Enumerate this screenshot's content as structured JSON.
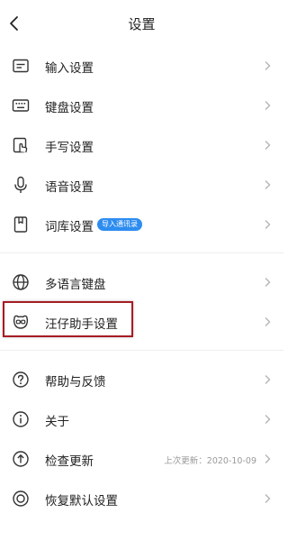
{
  "header": {
    "title": "设置",
    "back_icon": "chevron-left-icon"
  },
  "groups": [
    {
      "items": [
        {
          "label": "输入设置",
          "icon": "keyboard-input-icon"
        },
        {
          "label": "键盘设置",
          "icon": "keyboard-icon"
        },
        {
          "label": "手写设置",
          "icon": "handwriting-icon"
        },
        {
          "label": "语音设置",
          "icon": "microphone-icon"
        },
        {
          "label": "词库设置",
          "icon": "dictionary-icon",
          "badge": "导入通讯录"
        }
      ]
    },
    {
      "items": [
        {
          "label": "多语言键盘",
          "icon": "globe-icon"
        },
        {
          "label": "汪仔助手设置",
          "icon": "mascot-icon"
        }
      ]
    },
    {
      "items": [
        {
          "label": "帮助与反馈",
          "icon": "help-icon"
        },
        {
          "label": "关于",
          "icon": "info-icon"
        },
        {
          "label": "检查更新",
          "icon": "update-icon",
          "hint": "上次更新：2020-10-09"
        },
        {
          "label": "恢复默认设置",
          "icon": "reset-icon"
        }
      ]
    }
  ],
  "colors": {
    "badge": "#2d8cf0",
    "highlight_border": "#a61b24",
    "divider": "#eeeeee"
  }
}
